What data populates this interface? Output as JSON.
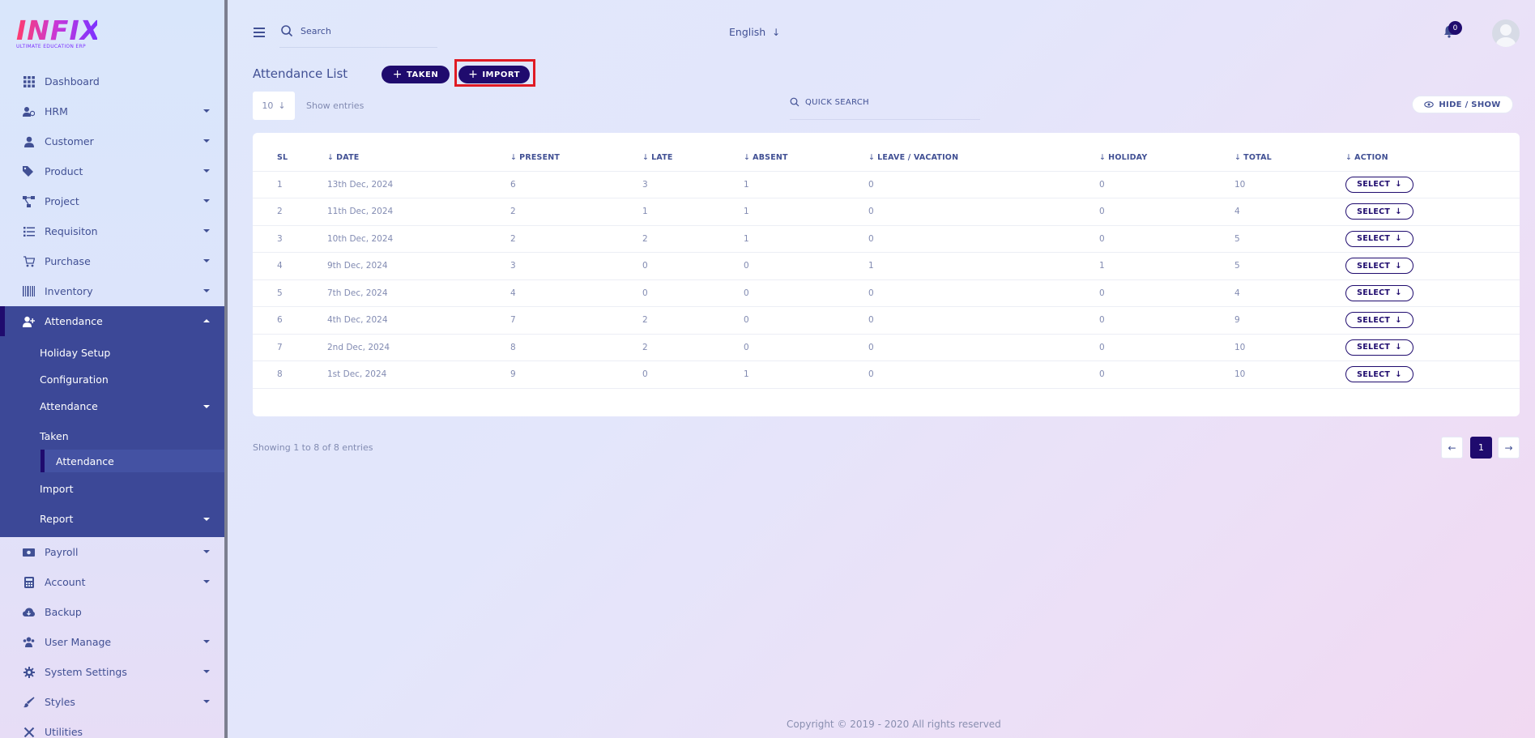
{
  "logo": {
    "text": "INFIX",
    "subtitle": "ULTIMATE EDUCATION ERP"
  },
  "sidebar": {
    "items": [
      {
        "label": "Dashboard",
        "icon": "grid-icon",
        "caret": false
      },
      {
        "label": "HRM",
        "icon": "users-cog-icon",
        "caret": true
      },
      {
        "label": "Customer",
        "icon": "user-tie-icon",
        "caret": true
      },
      {
        "label": "Product",
        "icon": "tags-icon",
        "caret": true
      },
      {
        "label": "Project",
        "icon": "project-diagram-icon",
        "caret": true
      },
      {
        "label": "Requisiton",
        "icon": "list-icon",
        "caret": true
      },
      {
        "label": "Purchase",
        "icon": "cart-icon",
        "caret": true
      },
      {
        "label": "Inventory",
        "icon": "barcode-icon",
        "caret": true
      },
      {
        "label": "Attendance",
        "icon": "user-plus-icon",
        "caret": true,
        "active": true
      }
    ],
    "submenu": {
      "holiday_setup": "Holiday Setup",
      "configuration": "Configuration",
      "attendance": "Attendance",
      "taken": "Taken",
      "attendance_deep": "Attendance",
      "import": "Import",
      "report": "Report"
    },
    "items_after": [
      {
        "label": "Payroll",
        "icon": "money-icon",
        "caret": true
      },
      {
        "label": "Account",
        "icon": "calculator-icon",
        "caret": true
      },
      {
        "label": "Backup",
        "icon": "cloud-download-icon",
        "caret": false
      },
      {
        "label": "User Manage",
        "icon": "users-icon",
        "caret": true
      },
      {
        "label": "System Settings",
        "icon": "gear-icon",
        "caret": true
      },
      {
        "label": "Styles",
        "icon": "brush-icon",
        "caret": true
      },
      {
        "label": "Utilities",
        "icon": "tools-icon",
        "caret": false
      }
    ]
  },
  "header": {
    "search_placeholder": "Search",
    "language": "English",
    "notification_count": "0"
  },
  "main": {
    "title": "Attendance List",
    "btn_taken": "TAKEN",
    "btn_import": "IMPORT",
    "entries_value": "10",
    "show_entries": "Show entries",
    "quick_search": "QUICK SEARCH",
    "hide_show": "HIDE / SHOW",
    "table": {
      "headers": [
        "SL",
        "DATE",
        "PRESENT",
        "LATE",
        "ABSENT",
        "LEAVE / VACATION",
        "HOLIDAY",
        "TOTAL",
        "ACTION"
      ],
      "action_label": "SELECT",
      "rows": [
        [
          "1",
          "13th Dec, 2024",
          "6",
          "3",
          "1",
          "0",
          "0",
          "10"
        ],
        [
          "2",
          "11th Dec, 2024",
          "2",
          "1",
          "1",
          "0",
          "0",
          "4"
        ],
        [
          "3",
          "10th Dec, 2024",
          "2",
          "2",
          "1",
          "0",
          "0",
          "5"
        ],
        [
          "4",
          "9th Dec, 2024",
          "3",
          "0",
          "0",
          "1",
          "1",
          "5"
        ],
        [
          "5",
          "7th Dec, 2024",
          "4",
          "0",
          "0",
          "0",
          "0",
          "4"
        ],
        [
          "6",
          "4th Dec, 2024",
          "7",
          "2",
          "0",
          "0",
          "0",
          "9"
        ],
        [
          "7",
          "2nd Dec, 2024",
          "8",
          "2",
          "0",
          "0",
          "0",
          "10"
        ],
        [
          "8",
          "1st Dec, 2024",
          "9",
          "0",
          "1",
          "0",
          "0",
          "10"
        ]
      ]
    },
    "showing": "Showing 1 to 8 of 8 entries",
    "current_page": "1"
  },
  "footer": {
    "copyright": "Copyright © 2019 - 2020 All rights reserved"
  },
  "colors": {
    "primary": "#1f0b6e",
    "sidebar_active": "#3c4897",
    "text": "#415094",
    "muted": "#828bb2",
    "highlight": "#e01b24"
  }
}
